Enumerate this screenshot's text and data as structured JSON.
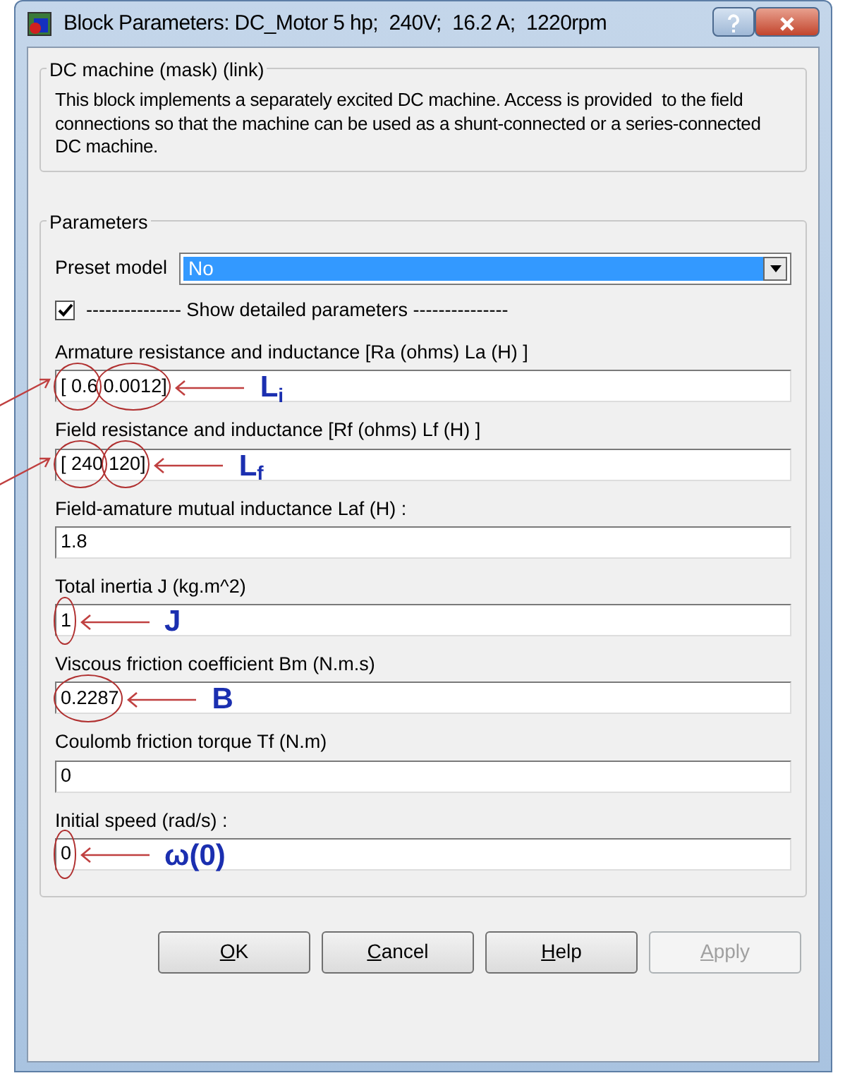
{
  "window": {
    "title": "Block Parameters: DC_Motor 5 hp;  240V;  16.2 A;  1220rpm"
  },
  "description": {
    "legend": "DC machine (mask) (link)",
    "text": "This block implements a separately excited DC machine. Access is provided  to the field connections so that the machine can be used as a shunt-connected or a series-connected  DC machine."
  },
  "parameters": {
    "legend": "Parameters",
    "preset": {
      "label": "Preset  model",
      "value": "No"
    },
    "detailed": {
      "checked": true,
      "label": "--------------- Show detailed parameters ---------------"
    },
    "fields": [
      {
        "label": "Armature resistance and inductance [Ra (ohms) La (H) ]",
        "value_parts": [
          {
            "text": "[ 0.6",
            "circled": true
          },
          {
            "text": "0.0012]",
            "circled": true
          }
        ],
        "annotation": {
          "label": "L$_{i}$",
          "side_arrow": true
        }
      },
      {
        "label": "Field resistance and inductance [Rf (ohms) Lf (H) ]",
        "value_parts": [
          {
            "text": "[ 240",
            "circled": true
          },
          {
            "text": "120]",
            "circled": true
          }
        ],
        "annotation": {
          "label": "L$_{f}$",
          "side_arrow": true
        }
      },
      {
        "label": "Field-amature mutual inductance Laf (H) :",
        "value_parts": [
          {
            "text": "1.8",
            "circled": false
          }
        ]
      },
      {
        "label": "Total inertia J (kg.m^2)",
        "value_parts": [
          {
            "text": "1",
            "circled": true
          }
        ],
        "annotation": {
          "label": "J"
        }
      },
      {
        "label": "Viscous friction coefficient Bm (N.m.s)",
        "value_parts": [
          {
            "text": "0.2287",
            "circled": true
          }
        ],
        "annotation": {
          "label": "B"
        }
      },
      {
        "label": "Coulomb friction torque Tf (N.m)",
        "value_parts": [
          {
            "text": "0",
            "circled": false
          }
        ]
      },
      {
        "label": "Initial speed (rad/s) :",
        "value_parts": [
          {
            "text": "0",
            "circled": true
          }
        ],
        "annotation": {
          "label": "ω(0)"
        }
      }
    ]
  },
  "buttons": [
    {
      "label": "OK",
      "mnemonic": true,
      "disabled": false
    },
    {
      "label": "Cancel",
      "mnemonic": true,
      "disabled": false
    },
    {
      "label": "Help",
      "mnemonic": true,
      "disabled": false
    },
    {
      "label": "Apply",
      "mnemonic": true,
      "disabled": true
    }
  ]
}
